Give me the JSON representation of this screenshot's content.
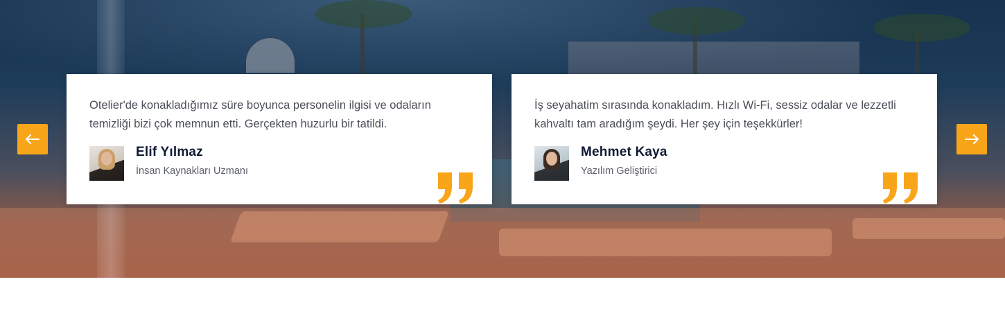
{
  "colors": {
    "accent": "#f9a51a",
    "name": "#101a33",
    "text": "#4b4f58"
  },
  "navigation": {
    "prev_icon": "arrow-left-icon",
    "next_icon": "arrow-right-icon"
  },
  "testimonials": [
    {
      "text": "Otelier'de konakladığımız süre boyunca personelin ilgisi ve odaların temizliği bizi çok memnun etti. Gerçekten huzurlu bir tatildi.",
      "name": "Elif Yılmaz",
      "role": "İnsan Kaynakları Uzmanı"
    },
    {
      "text": "İş seyahatim sırasında konakladım. Hızlı Wi-Fi, sessiz odalar ve lezzetli kahvaltı tam aradığım şeydi. Her şey için teşekkürler!",
      "name": "Mehmet Kaya",
      "role": "Yazılım Geliştirici"
    }
  ]
}
